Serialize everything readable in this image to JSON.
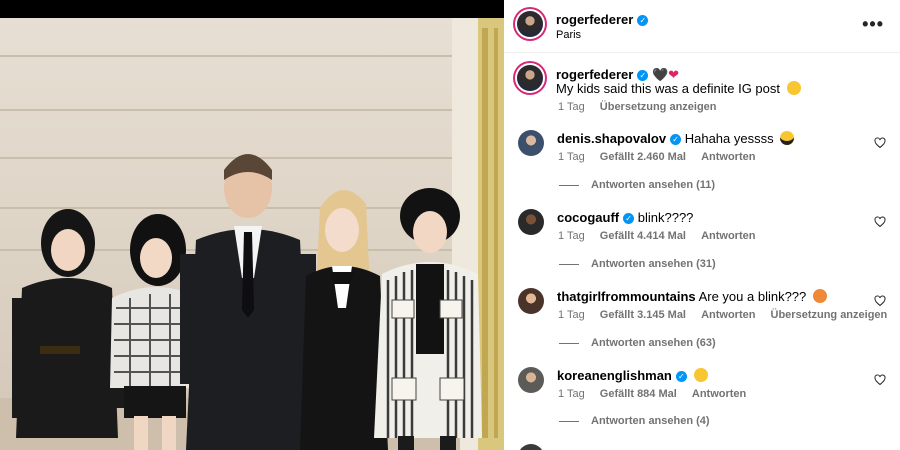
{
  "post": {
    "author": "rogerfederer",
    "location": "Paris",
    "more_icon": "more-horizontal-icon"
  },
  "caption": {
    "author": "rogerfederer",
    "text": "My kids said this was a definite IG post",
    "hearts": [
      "black-heart",
      "red-heart"
    ],
    "emoji": "smiling-face",
    "time": "1 Tag",
    "translate": "Übersetzung anzeigen"
  },
  "comments": [
    {
      "username": "denis.shapovalov",
      "verified": true,
      "text": "Hahaha yessss",
      "emoji": "sunglasses-face",
      "time": "1 Tag",
      "likes": "Gefällt 2.460 Mal",
      "reply": "Antworten",
      "view_replies": "Antworten ansehen (11)"
    },
    {
      "username": "cocogauff",
      "verified": true,
      "text": "blink????",
      "time": "1 Tag",
      "likes": "Gefällt 4.414 Mal",
      "reply": "Antworten",
      "view_replies": "Antworten ansehen (31)"
    },
    {
      "username": "thatgirlfrommountains",
      "verified": false,
      "text": "Are you a blink???",
      "emoji": "heart-eyes-face",
      "time": "1 Tag",
      "likes": "Gefällt 3.145 Mal",
      "reply": "Antworten",
      "translate": "Übersetzung anzeigen",
      "view_replies": "Antworten ansehen (63)"
    },
    {
      "username": "koreanenglishman",
      "verified": true,
      "text": "",
      "emoji": "surprised-face",
      "time": "1 Tag",
      "likes": "Gefällt 884 Mal",
      "reply": "Antworten",
      "view_replies": "Antworten ansehen (4)"
    }
  ],
  "colors": {
    "verified": "#0095f6",
    "secondary_text": "#737373",
    "story_ring": "#d62976"
  }
}
